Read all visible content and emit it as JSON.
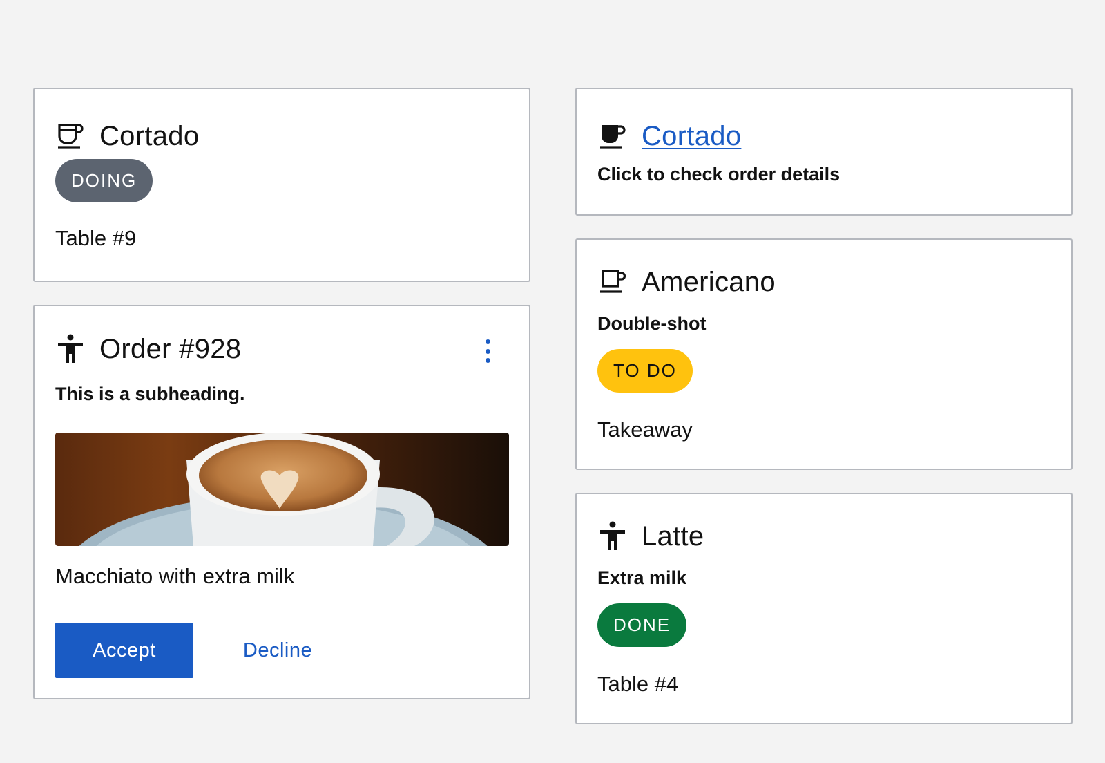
{
  "cards": {
    "cortado_status": {
      "icon": "cup-outline-icon",
      "title": "Cortado",
      "badge": "DOING",
      "footer": "Table #9"
    },
    "order": {
      "icon": "person-icon",
      "title": "Order #928",
      "menu_icon": "kebab-menu-icon",
      "subheading": "This is a subheading.",
      "image": "coffee-cup-latte-art-photo",
      "description": "Macchiato with extra milk",
      "accept_label": "Accept",
      "decline_label": "Decline"
    },
    "cortado_link": {
      "icon": "cup-filled-icon",
      "title": "Cortado",
      "subheading": "Click to check order details"
    },
    "americano": {
      "icon": "mug-icon",
      "title": "Americano",
      "subheading": "Double-shot",
      "badge": "TO DO",
      "footer": "Takeaway"
    },
    "latte": {
      "icon": "person-icon",
      "title": "Latte",
      "subheading": "Extra milk",
      "badge": "DONE",
      "footer": "Table #4"
    }
  },
  "colors": {
    "background": "#f3f3f3",
    "card_border": "#b5b8be",
    "primary": "#1a5bc4",
    "badge_doing": "#5c6470",
    "badge_todo": "#ffc20e",
    "badge_done": "#0a7a3e"
  }
}
